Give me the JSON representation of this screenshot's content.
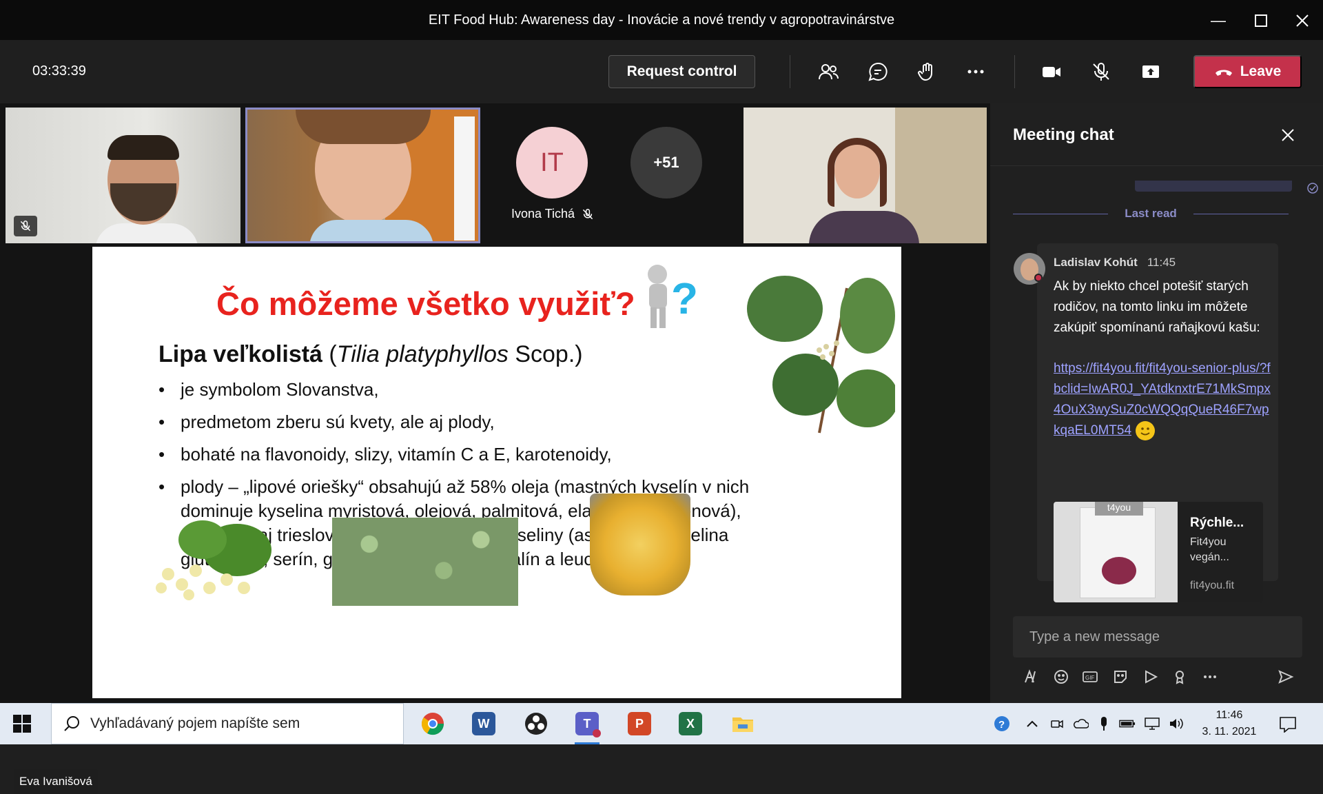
{
  "window": {
    "title": "EIT Food Hub: Awareness day - Inovácie a nové trendy v agropotravinárstve"
  },
  "toolbar": {
    "timer": "03:33:39",
    "request_control": "Request control",
    "leave": "Leave"
  },
  "participants": {
    "ivona_initials": "IT",
    "ivona_name": "Ivona Tichá",
    "more_count": "+51",
    "presenter_name": "Eva Ivanišová"
  },
  "slide": {
    "title": "Čo môžeme všetko využiť?",
    "subtitle_bold": "Lipa veľkolistá",
    "subtitle_open": " (",
    "subtitle_italic": "Tilia platyphyllos",
    "subtitle_rest": " Scop.)",
    "bullets": [
      "je symbolom Slovanstva,",
      "predmetom zberu sú kvety, ale aj plody,",
      "bohaté na flavonoidy, slizy, vitamín C a E, karotenoidy,",
      "plody – „lipové oriešky“ obsahujú až 58% oleja (mastných kyselín v nich dominuje kyselina myristová, olejová, palmitová, elaidová, vakcénová), obsahujú aj triesloviny, sacharidy, aminokyseliny (asparagín, kyselina glutámová, serín, glycín, alanín, tyrozín, valín a leucín."
    ]
  },
  "chat": {
    "title": "Meeting chat",
    "last_read": "Last read",
    "message": {
      "author": "Ladislav Kohút",
      "time": "11:45",
      "text": "Ak by niekto chcel potešiť starých rodičov, na tomto linku im môžete zakúpiť spomínanú raňajkovú kašu:",
      "link": "https://fit4you.fit/fit4you-senior-plus/?fbclid=IwAR0J_YAtdknxtrE71MkSmpx4OuX3wySuZ0cWQQqQueR46F7wpkqaEL0MT54"
    },
    "card": {
      "title": "Rýchle...",
      "desc": "Fit4you vegán...",
      "domain": "fit4you.fit",
      "thumb_label": "t4you"
    },
    "compose_placeholder": "Type a new message"
  },
  "taskbar": {
    "search_placeholder": "Vyhľadávaný pojem napíšte sem",
    "time": "11:46",
    "date": "3. 11. 2021"
  },
  "colors": {
    "accent": "#6264a7",
    "leave": "#c4314b",
    "slide_title": "#e8231e",
    "link": "#9ea2ff"
  }
}
